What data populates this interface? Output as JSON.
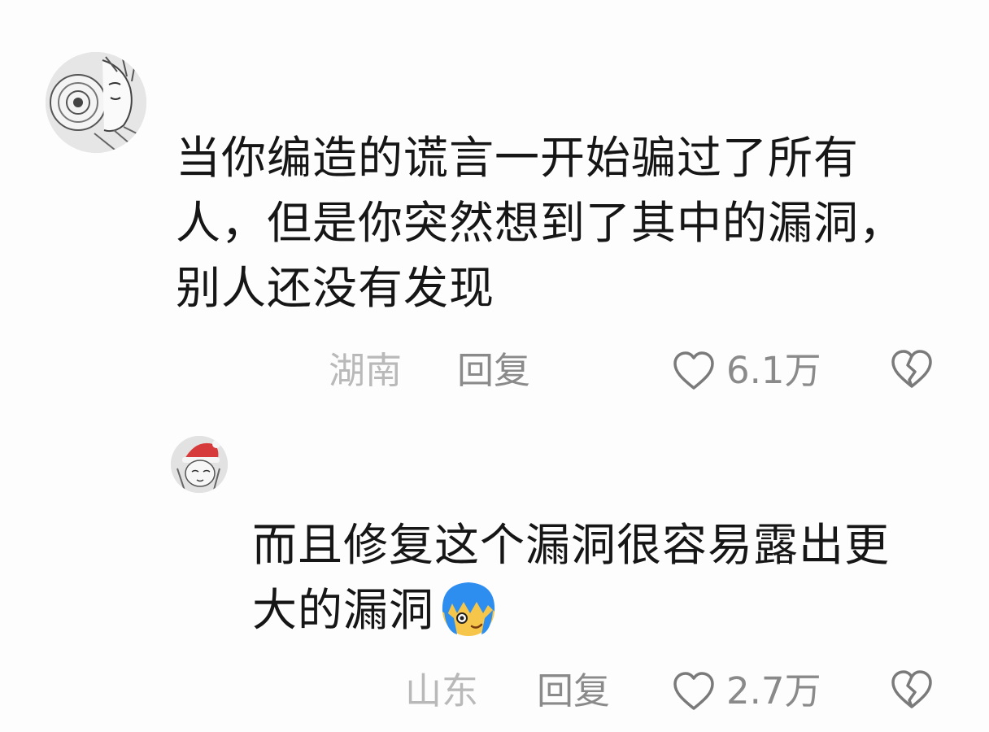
{
  "comments": [
    {
      "avatar_icon": "manga-character-avatar",
      "text_lines": [
        "当你编造的谎言一开始骗过了所有",
        "人，但是你突然想到了其中的漏洞，",
        "别人还没有发现"
      ],
      "location": "湖南",
      "reply_label": "回复",
      "likes": "6.1万",
      "like_icon": "heart-outline-icon",
      "dislike_icon": "broken-heart-icon"
    },
    {
      "avatar_icon": "manga-character-santa-hat-avatar",
      "text_lines": [
        "而且修复这个漏洞很容易露出更",
        "大的漏洞"
      ],
      "trailing_emoji": "blue-hair-face-emoji",
      "location": "山东",
      "reply_label": "回复",
      "likes": "2.7万",
      "like_icon": "heart-outline-icon",
      "dislike_icon": "broken-heart-icon"
    }
  ],
  "colors": {
    "background": "#fdfdfd",
    "text": "#161616",
    "meta": "#8a8a8a",
    "location": "#b9b9b9",
    "emoji_hair": "#2d8ef0",
    "emoji_face": "#f6c64a"
  }
}
